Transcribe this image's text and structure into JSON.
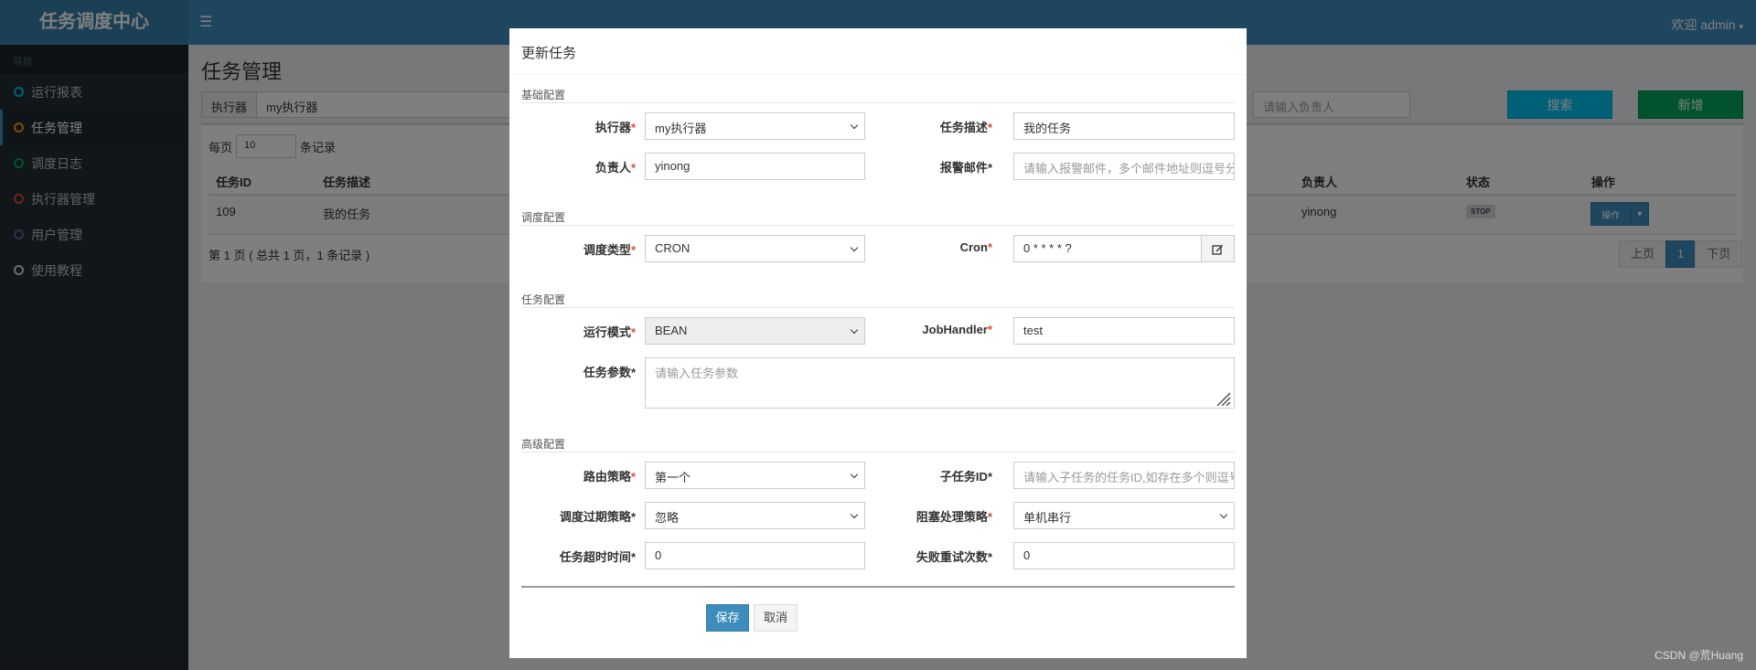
{
  "app": {
    "logo": "任务调度中心",
    "welcome": "欢迎 admin"
  },
  "sidebar": {
    "header": "导航",
    "items": [
      {
        "label": "运行报表",
        "color": "#00c0ef"
      },
      {
        "label": "任务管理",
        "color": "#f39c12"
      },
      {
        "label": "调度日志",
        "color": "#00a65a"
      },
      {
        "label": "执行器管理",
        "color": "#dd4b39"
      },
      {
        "label": "用户管理",
        "color": "#605ca8"
      },
      {
        "label": "使用教程",
        "color": "#d2d6de"
      }
    ]
  },
  "page": {
    "title": "任务管理",
    "filter_executor_label": "执行器",
    "filter_executor_value": "my执行器",
    "owner_placeholder": "请输入负责人",
    "search_label": "搜索",
    "add_label": "新增",
    "per_page_label": "每页",
    "per_page_value": "10",
    "per_page_suffix": "条记录",
    "table": {
      "headers": {
        "id": "任务ID",
        "desc": "任务描述",
        "owner": "负责人",
        "status": "状态",
        "ops": "操作"
      },
      "row": {
        "id": "109",
        "desc": "我的任务",
        "owner": "yinong",
        "status": "STOP",
        "op": "操作"
      }
    },
    "page_info": "第 1 页 ( 总共 1 页，1 条记录 )",
    "pager": {
      "prev": "上页",
      "current": "1",
      "next": "下页"
    }
  },
  "modal": {
    "title": "更新任务",
    "sections": {
      "basic": "基础配置",
      "schedule": "调度配置",
      "job": "任务配置",
      "advanced": "高级配置"
    },
    "fields": {
      "executor": {
        "label": "执行器",
        "value": "my执行器"
      },
      "job_desc": {
        "label": "任务描述",
        "value": "我的任务"
      },
      "owner": {
        "label": "负责人",
        "value": "yinong"
      },
      "alarm_email": {
        "label": "报警邮件",
        "placeholder": "请输入报警邮件，多个邮件地址则逗号分隔"
      },
      "schedule_type": {
        "label": "调度类型",
        "value": "CRON"
      },
      "cron": {
        "label": "Cron",
        "value": "0 * * * * ?"
      },
      "run_mode": {
        "label": "运行模式",
        "value": "BEAN"
      },
      "job_handler": {
        "label": "JobHandler",
        "value": "test"
      },
      "job_param": {
        "label": "任务参数",
        "placeholder": "请输入任务参数"
      },
      "route_strategy": {
        "label": "路由策略",
        "value": "第一个"
      },
      "child_job_id": {
        "label": "子任务ID",
        "placeholder": "请输入子任务的任务ID,如存在多个则逗号分隔"
      },
      "misfire_strategy": {
        "label": "调度过期策略",
        "value": "忽略"
      },
      "block_strategy": {
        "label": "阻塞处理策略",
        "value": "单机串行"
      },
      "timeout": {
        "label": "任务超时时间",
        "value": "0"
      },
      "fail_retry": {
        "label": "失败重试次数",
        "value": "0"
      }
    },
    "save_label": "保存",
    "cancel_label": "取消"
  },
  "watermark": "CSDN @荒Huang"
}
